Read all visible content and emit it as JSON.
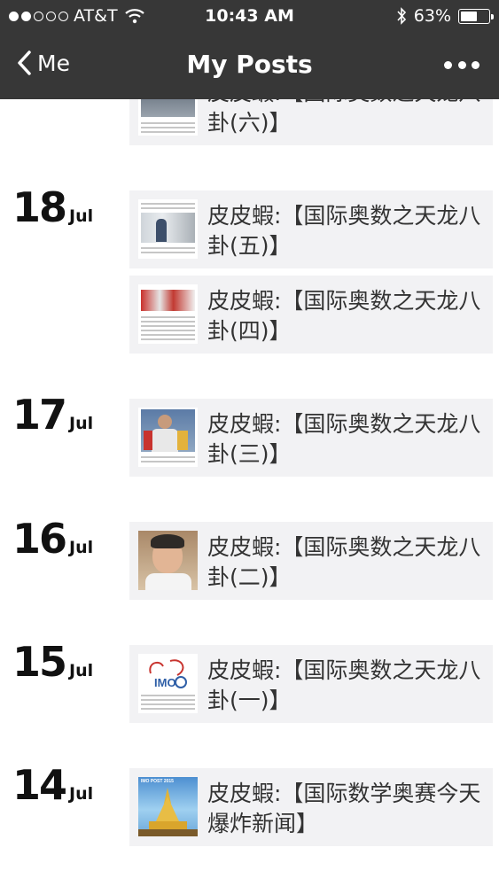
{
  "status_bar": {
    "carrier": "AT&T",
    "time": "10:43 AM",
    "battery": "63%",
    "battery_level": 0.63
  },
  "nav": {
    "back_label": "Me",
    "title": "My Posts"
  },
  "posts": [
    {
      "title": "皮皮蝦:【国际奥数之天龙八卦(六)】"
    },
    {
      "title": "皮皮蝦:【国际奥数之天龙八卦(五)】"
    },
    {
      "title": "皮皮蝦:【国际奥数之天龙八卦(四)】"
    },
    {
      "title": "皮皮蝦:【国际奥数之天龙八卦(三)】"
    },
    {
      "title": "皮皮蝦:【国际奥数之天龙八卦(二)】"
    },
    {
      "title": "皮皮蝦:【国际奥数之天龙八卦(一)】"
    },
    {
      "title": "皮皮蝦:【国际数学奥赛今天爆炸新闻】"
    }
  ],
  "dates": [
    {
      "day": "18",
      "month": "Jul"
    },
    {
      "day": "17",
      "month": "Jul"
    },
    {
      "day": "16",
      "month": "Jul"
    },
    {
      "day": "15",
      "month": "Jul"
    },
    {
      "day": "14",
      "month": "Jul"
    }
  ],
  "thumb_text": {
    "imo": "IMO",
    "imo_post": "IMO POST 2015"
  },
  "colors": {
    "nav_bar": "#373737",
    "card_bg": "#f2f2f4",
    "title_text": "#333333"
  }
}
